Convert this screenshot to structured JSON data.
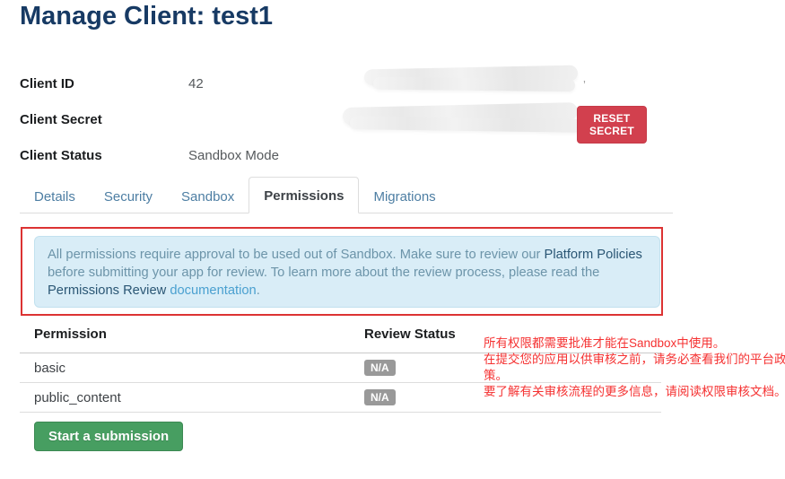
{
  "page": {
    "title": "Manage Client: test1"
  },
  "client_info": {
    "client_id": {
      "label": "Client ID",
      "value_visible_part": "42",
      "redacted": true
    },
    "client_secret": {
      "label": "Client Secret",
      "value_visible_part": "",
      "redacted": true
    },
    "client_status": {
      "label": "Client Status",
      "value": "Sandbox Mode"
    },
    "reset_secret_label": "RESET SECRET"
  },
  "tabs": [
    {
      "label": "Details",
      "active": false
    },
    {
      "label": "Security",
      "active": false
    },
    {
      "label": "Sandbox",
      "active": false
    },
    {
      "label": "Permissions",
      "active": true
    },
    {
      "label": "Migrations",
      "active": false
    }
  ],
  "alert": {
    "part1": "All permissions require approval to be used out of Sandbox. Make sure to review our ",
    "link_platform_policies": "Platform Policies",
    "part2": " before submitting your app for review. To learn more about the review process, please read the ",
    "link_permissions_review": "Permissions Review",
    "part3": " ",
    "link_documentation": "documentation",
    "part4": "."
  },
  "permissions_table": {
    "headers": [
      "Permission",
      "Review Status"
    ],
    "rows": [
      {
        "permission": "basic",
        "review_status": "N/A"
      },
      {
        "permission": "public_content",
        "review_status": "N/A"
      }
    ]
  },
  "annotation_overlay": {
    "lines": [
      "所有权限都需要批准才能在Sandbox中使用。",
      "在提交您的应用以供审核之前，请务必查看我们的平台政策。",
      "要了解有关审核流程的更多信息，请阅读权限审核文档。"
    ]
  },
  "actions": {
    "start_submission_label": "Start a submission"
  },
  "colors": {
    "title_navy": "#173a64",
    "reset_button_red": "#d2404e",
    "alert_background": "#d9edf7",
    "alert_text": "#6c94a9",
    "badge_gray": "#999999",
    "submit_button_green": "#479e61",
    "annotation_red": "#f53131",
    "annotation_border_red": "#dc3333"
  }
}
